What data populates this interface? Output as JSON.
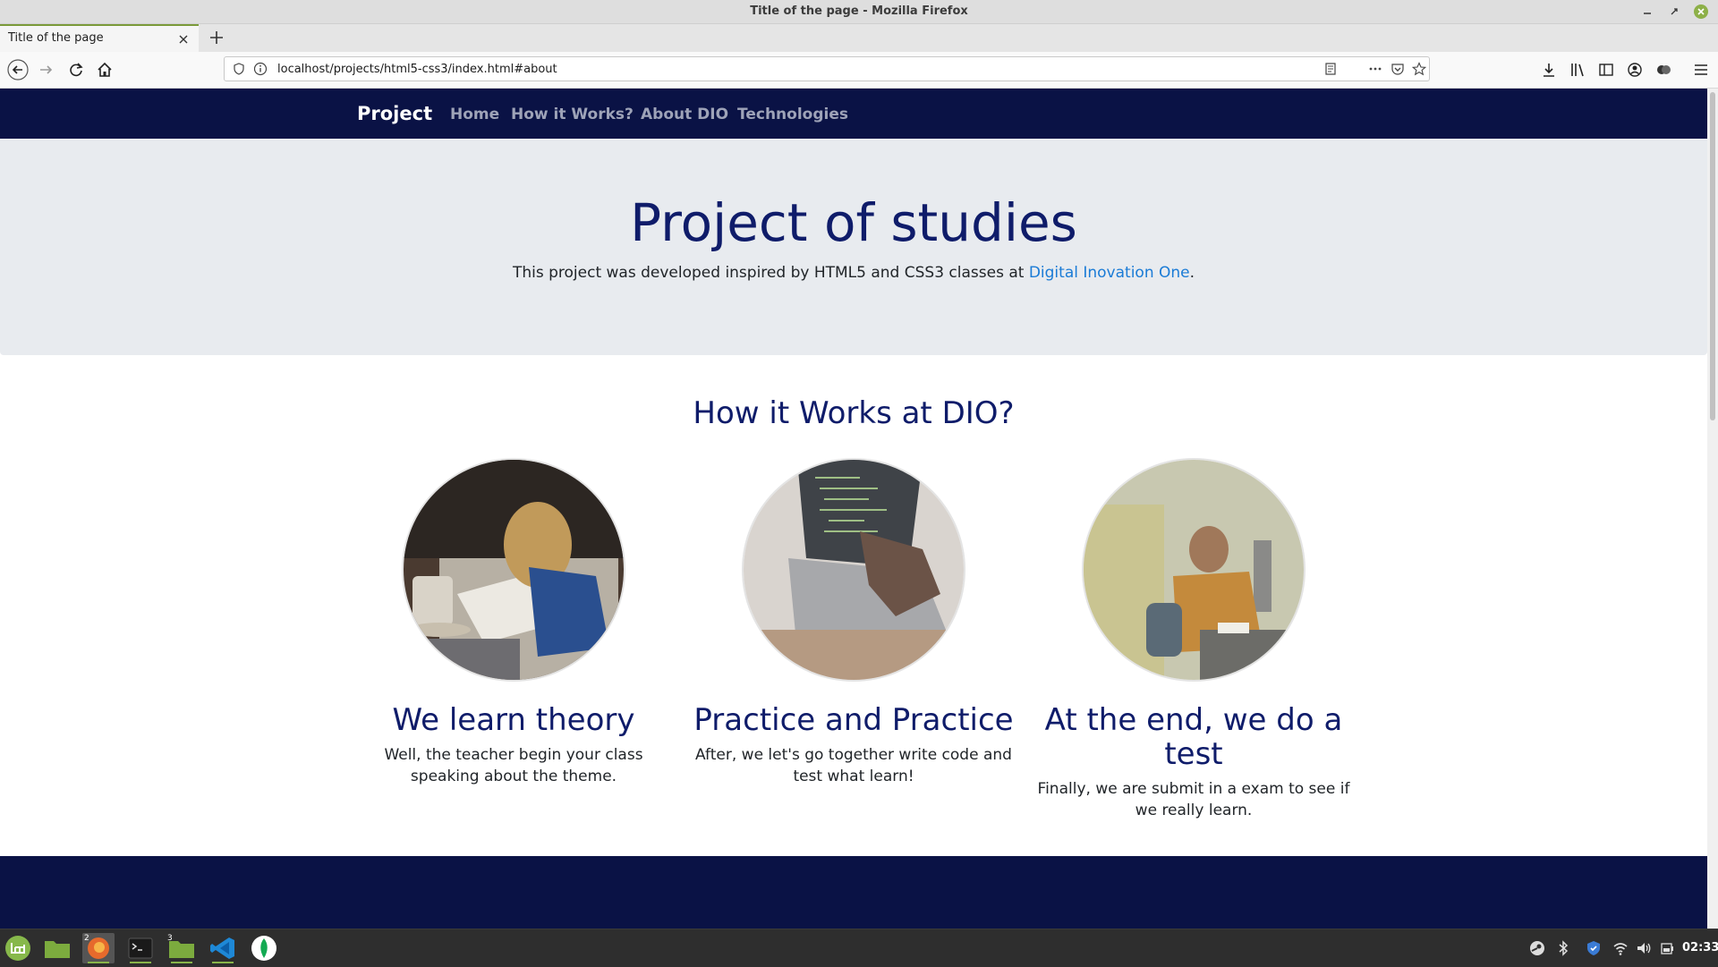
{
  "window": {
    "title": "Title of the page - Mozilla Firefox"
  },
  "tab": {
    "title": "Title of the page"
  },
  "urlbar": {
    "url": "localhost/projects/html5-css3/index.html#about"
  },
  "site": {
    "brand": "Project",
    "nav": [
      "Home",
      "How it Works?",
      "About DIO",
      "Technologies"
    ]
  },
  "hero": {
    "title": "Project of studies",
    "text": "This project was developed inspired by HTML5 and CSS3 classes at ",
    "link": "Digital Inovation One",
    "text_end": "."
  },
  "how": {
    "title": "How it Works at DIO?",
    "cards": [
      {
        "title": "We learn theory",
        "text": "Well, the teacher begin your class speaking about the theme."
      },
      {
        "title": "Practice and Practice",
        "text": "After, we let's go together write code and test what learn!"
      },
      {
        "title": "At the end, we do a test",
        "text": "Finally, we are submit in a exam to see if we really learn."
      }
    ]
  },
  "taskbar": {
    "badges": [
      "2",
      "3"
    ],
    "clock": "02:33"
  },
  "colors": {
    "navbar": "#0a1245",
    "heading": "#0f1c6a",
    "hero_bg": "#e8ebef",
    "link": "#1a7bd6"
  }
}
